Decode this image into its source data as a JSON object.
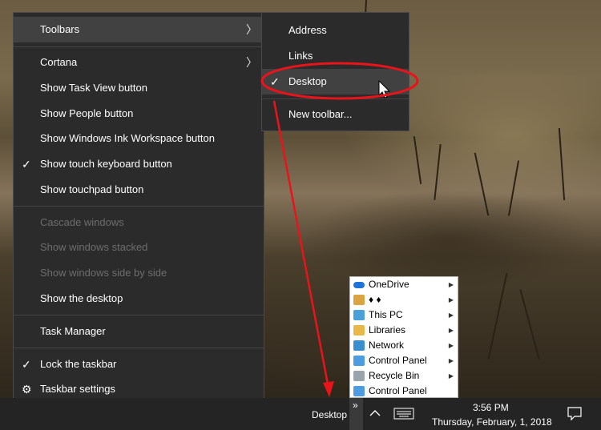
{
  "context_menu": {
    "items": [
      {
        "label": "Toolbars"
      },
      {
        "label": "Cortana"
      },
      {
        "label": "Show Task View button"
      },
      {
        "label": "Show People button"
      },
      {
        "label": "Show Windows Ink Workspace button"
      },
      {
        "label": "Show touch keyboard button"
      },
      {
        "label": "Show touchpad button"
      },
      {
        "label": "Cascade windows"
      },
      {
        "label": "Show windows stacked"
      },
      {
        "label": "Show windows side by side"
      },
      {
        "label": "Show the desktop"
      },
      {
        "label": "Task Manager"
      },
      {
        "label": "Lock the taskbar"
      },
      {
        "label": "Taskbar settings"
      }
    ]
  },
  "toolbars_submenu": {
    "items": [
      {
        "label": "Address"
      },
      {
        "label": "Links"
      },
      {
        "label": "Desktop"
      },
      {
        "label": "New toolbar..."
      }
    ]
  },
  "desktop_flyout": {
    "items": [
      {
        "label": "OneDrive",
        "icon": "onedrive-icon",
        "color": "#1e72d8"
      },
      {
        "label": "♦ ♦",
        "icon": "user-folder-icon",
        "color": "#d9a441"
      },
      {
        "label": "This PC",
        "icon": "computer-icon",
        "color": "#4aa0d8"
      },
      {
        "label": "Libraries",
        "icon": "libraries-icon",
        "color": "#e8b94a"
      },
      {
        "label": "Network",
        "icon": "network-icon",
        "color": "#3a8fd1"
      },
      {
        "label": "Control Panel",
        "icon": "control-panel-icon",
        "color": "#4d9be0"
      },
      {
        "label": "Recycle Bin",
        "icon": "recycle-bin-icon",
        "color": "#9aa4ad"
      },
      {
        "label": "Control Panel",
        "icon": "control-panel-icon",
        "color": "#4d9be0"
      }
    ]
  },
  "taskbar": {
    "toolbar_label": "Desktop",
    "chevron": "»",
    "time": "3:56 PM",
    "date": "Thursday, February, 1, 2018"
  },
  "colors": {
    "annotation": "#e8141a",
    "menu_bg": "#2b2b2b",
    "taskbar_bg": "#242424"
  }
}
